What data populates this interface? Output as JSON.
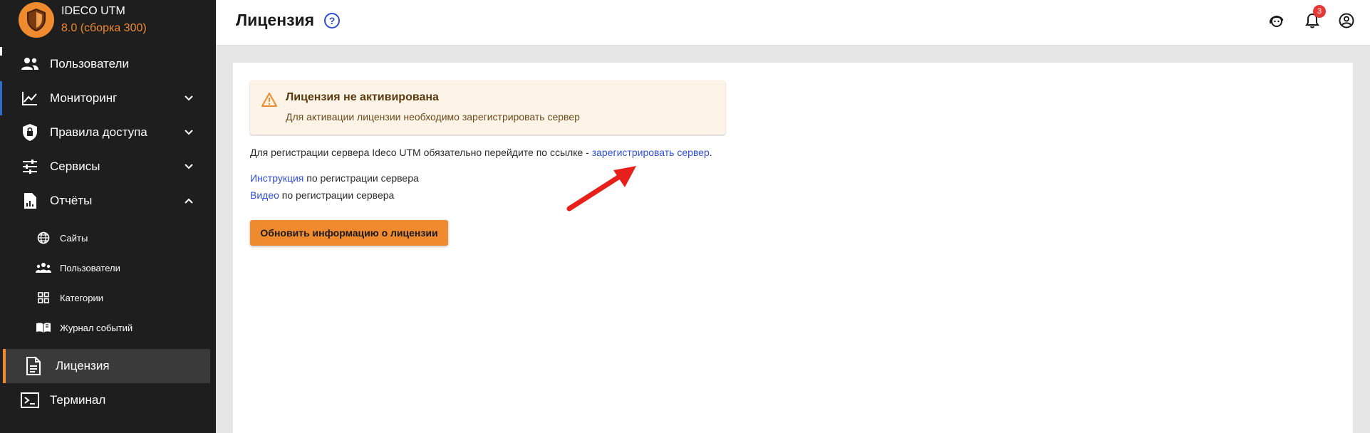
{
  "brand": {
    "name": "IDECO UTM",
    "version": "8.0 (сборка 300)"
  },
  "sidebar": {
    "items": [
      {
        "label": "Пользователи",
        "icon": "users-icon"
      },
      {
        "label": "Мониторинг",
        "icon": "chart-line-icon"
      },
      {
        "label": "Правила доступа",
        "icon": "shield-lock-icon"
      },
      {
        "label": "Сервисы",
        "icon": "sliders-icon"
      },
      {
        "label": "Отчёты",
        "icon": "report-icon"
      }
    ],
    "sub_items": [
      {
        "label": "Сайты",
        "icon": "globe-icon"
      },
      {
        "label": "Пользователи",
        "icon": "users-icon"
      },
      {
        "label": "Категории",
        "icon": "grid-icon"
      },
      {
        "label": "Журнал событий",
        "icon": "book-icon"
      }
    ],
    "active": {
      "label": "Лицензия",
      "icon": "document-icon"
    },
    "terminal": {
      "label": "Терминал",
      "icon": "terminal-icon"
    }
  },
  "header": {
    "title": "Лицензия",
    "notification_count": "3"
  },
  "alert": {
    "title": "Лицензия не активирована",
    "text": "Для активации лицензии необходимо зарегистрировать сервер"
  },
  "content": {
    "register_text": "Для регистрации сервера Ideco UTM обязательно перейдите по ссылке -",
    "register_link": "зарегистрировать сервер",
    "register_end": ".",
    "instruction_link": "Инструкция",
    "instruction_text": "по регистрации сервера",
    "video_link": "Видео",
    "video_text": "по регистрации сервера",
    "refresh_button": "Обновить информацию о лицензии"
  },
  "colors": {
    "accent": "#ef8a2e",
    "link": "#2d4fd6",
    "sidebar": "#1e1e1e",
    "alert_bg": "#fdf3e7",
    "arrow": "#e8201c"
  }
}
